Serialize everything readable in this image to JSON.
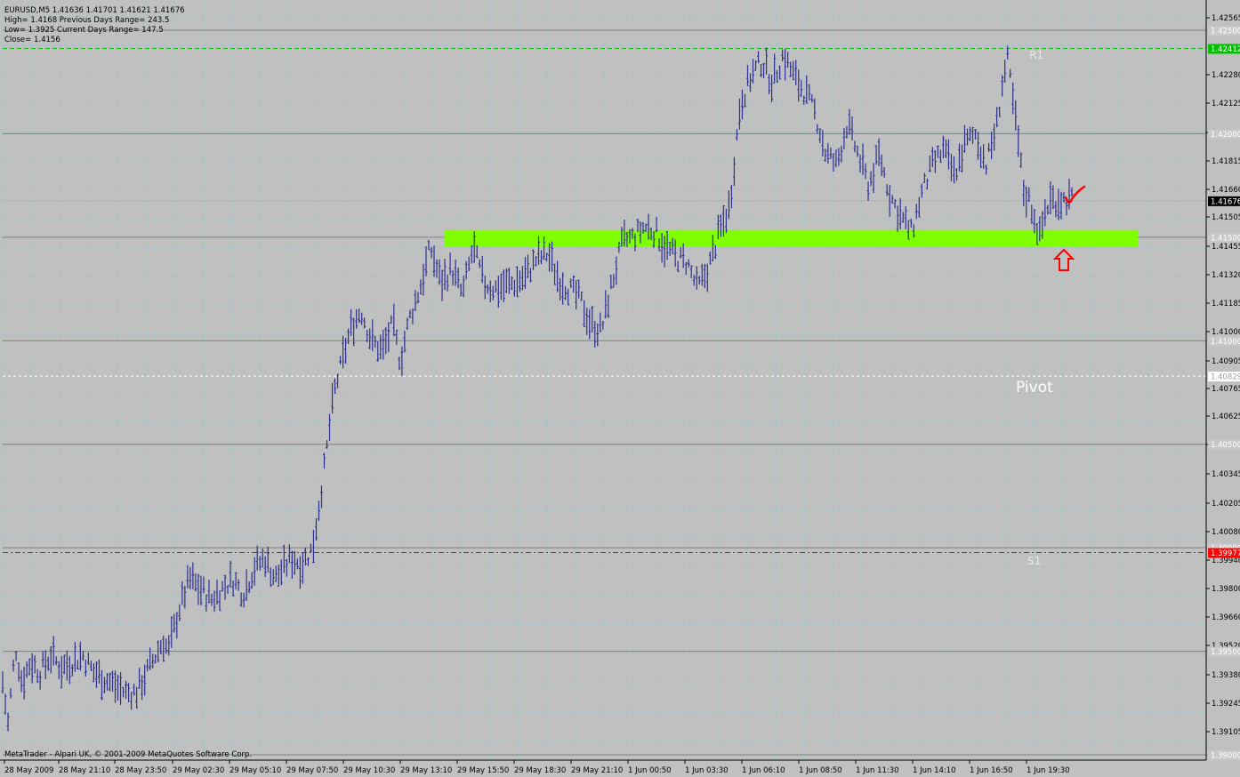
{
  "window": {
    "symbol_header": "EURUSD,M5  1.41636 1.41701 1.41621 1.41676",
    "info_lines": [
      "High= 1.4168      Previous Days Range= 243.5",
      "Low= 1.3925      Current Days Range= 147.5",
      "Close= 1.4156"
    ],
    "copyright": "MetaTrader - Alpari UK, © 2001-2009 MetaQuotes Software Corp."
  },
  "colors": {
    "background": "#c0c0c0",
    "price_bars": "#2f2f8f",
    "grid": "#9ec4c8",
    "pivot_levels": "#808080",
    "support_zone": "#7fff00",
    "r1_line": "#00c000",
    "s1_line": "#ff0000",
    "current_price_tag": "#000000",
    "annotation": "#ff0000"
  },
  "chart_data": {
    "type": "bar",
    "symbol": "EURUSD",
    "timeframe": "M5",
    "ohlc_last": {
      "open": 1.41636,
      "high": 1.41701,
      "low": 1.41621,
      "close": 1.41676
    },
    "ylim": [
      1.3895,
      1.4259
    ],
    "y_ticks": [
      "1.42565",
      "1.42280",
      "1.42125",
      "1.41970",
      "1.41815",
      "1.41660",
      "1.41505",
      "1.41455",
      "1.41320",
      "1.41185",
      "1.41000",
      "1.40905",
      "1.40765",
      "1.40625",
      "1.40485",
      "1.40345",
      "1.40205",
      "1.40080",
      "1.39940",
      "1.39800",
      "1.39660",
      "1.39520",
      "1.39380",
      "1.39245",
      "1.39105"
    ],
    "x_ticks": [
      "28 May 2009",
      "28 May 21:10",
      "28 May 23:50",
      "29 May 02:30",
      "29 May 05:10",
      "29 May 07:50",
      "29 May 10:30",
      "29 May 13:10",
      "29 May 15:50",
      "29 May 18:30",
      "29 May 21:10",
      "1 Jun 00:50",
      "1 Jun 03:30",
      "1 Jun 06:10",
      "1 Jun 08:50",
      "1 Jun 11:30",
      "1 Jun 14:10",
      "1 Jun 16:50",
      "1 Jun 19:30"
    ],
    "levels": [
      {
        "name": "1.42500",
        "value": 1.425
      },
      {
        "name": "1.42412",
        "value": 1.42412
      },
      {
        "name": "1.42000",
        "value": 1.42
      },
      {
        "name": "1.41500",
        "value": 1.415
      },
      {
        "name": "1.41000",
        "value": 1.41
      },
      {
        "name": "1.40829",
        "value": 1.40829
      },
      {
        "name": "1.40500",
        "value": 1.405
      },
      {
        "name": "1.40000",
        "value": 1.4
      },
      {
        "name": "1.39977",
        "value": 1.39977
      },
      {
        "name": "1.39500",
        "value": 1.395
      },
      {
        "name": "1.39000",
        "value": 1.39
      }
    ],
    "current_price": "1.41676",
    "pivot_labels": {
      "r1": "R1",
      "pivot": "Pivot",
      "s1": "S1"
    },
    "support_zone": {
      "from": 1.41455,
      "to": 1.41535
    },
    "price_path": [
      [
        0,
        1.3935
      ],
      [
        0.005,
        1.3915
      ],
      [
        0.012,
        1.3952
      ],
      [
        0.018,
        1.3935
      ],
      [
        0.026,
        1.3945
      ],
      [
        0.035,
        1.394
      ],
      [
        0.045,
        1.3948
      ],
      [
        0.055,
        1.3942
      ],
      [
        0.065,
        1.3945
      ],
      [
        0.075,
        1.3948
      ],
      [
        0.085,
        1.394
      ],
      [
        0.1,
        1.3935
      ],
      [
        0.115,
        1.393
      ],
      [
        0.125,
        1.393
      ],
      [
        0.14,
        1.3945
      ],
      [
        0.15,
        1.3955
      ],
      [
        0.155,
        1.395
      ],
      [
        0.165,
        1.397
      ],
      [
        0.175,
        1.3985
      ],
      [
        0.185,
        1.398
      ],
      [
        0.195,
        1.3975
      ],
      [
        0.205,
        1.398
      ],
      [
        0.215,
        1.3985
      ],
      [
        0.225,
        1.3978
      ],
      [
        0.235,
        1.399
      ],
      [
        0.245,
        1.3995
      ],
      [
        0.255,
        1.3985
      ],
      [
        0.27,
        1.3995
      ],
      [
        0.28,
        1.3992
      ],
      [
        0.29,
        1.4
      ],
      [
        0.3,
        1.4035
      ],
      [
        0.31,
        1.4075
      ],
      [
        0.315,
        1.4085
      ],
      [
        0.325,
        1.4105
      ],
      [
        0.335,
        1.4115
      ],
      [
        0.345,
        1.41
      ],
      [
        0.355,
        1.4095
      ],
      [
        0.365,
        1.4108
      ],
      [
        0.372,
        1.409
      ],
      [
        0.38,
        1.411
      ],
      [
        0.39,
        1.4125
      ],
      [
        0.4,
        1.4145
      ],
      [
        0.41,
        1.4128
      ],
      [
        0.42,
        1.4135
      ],
      [
        0.43,
        1.4122
      ],
      [
        0.44,
        1.4145
      ],
      [
        0.45,
        1.4128
      ],
      [
        0.46,
        1.4125
      ],
      [
        0.47,
        1.4127
      ],
      [
        0.48,
        1.4128
      ],
      [
        0.49,
        1.4132
      ],
      [
        0.5,
        1.414
      ],
      [
        0.51,
        1.4142
      ],
      [
        0.52,
        1.413
      ],
      [
        0.53,
        1.4125
      ],
      [
        0.54,
        1.412
      ],
      [
        0.55,
        1.4108
      ],
      [
        0.56,
        1.4105
      ],
      [
        0.57,
        1.4128
      ],
      [
        0.58,
        1.4148
      ],
      [
        0.59,
        1.415
      ],
      [
        0.6,
        1.4155
      ],
      [
        0.61,
        1.4153
      ],
      [
        0.62,
        1.4145
      ],
      [
        0.63,
        1.414
      ],
      [
        0.64,
        1.4138
      ],
      [
        0.65,
        1.4125
      ],
      [
        0.66,
        1.4135
      ],
      [
        0.67,
        1.4152
      ],
      [
        0.68,
        1.4165
      ],
      [
        0.69,
        1.4215
      ],
      [
        0.7,
        1.4228
      ],
      [
        0.71,
        1.4235
      ],
      [
        0.72,
        1.4225
      ],
      [
        0.73,
        1.4238
      ],
      [
        0.74,
        1.4228
      ],
      [
        0.75,
        1.422
      ],
      [
        0.76,
        1.421
      ],
      [
        0.77,
        1.419
      ],
      [
        0.78,
        1.4185
      ],
      [
        0.79,
        1.4205
      ],
      [
        0.8,
        1.419
      ],
      [
        0.81,
        1.4175
      ],
      [
        0.82,
        1.419
      ],
      [
        0.83,
        1.417
      ],
      [
        0.84,
        1.416
      ],
      [
        0.85,
        1.4152
      ],
      [
        0.86,
        1.4172
      ],
      [
        0.87,
        1.4185
      ],
      [
        0.88,
        1.4192
      ],
      [
        0.89,
        1.418
      ],
      [
        0.9,
        1.4195
      ],
      [
        0.91,
        1.42
      ],
      [
        0.92,
        1.4185
      ],
      [
        0.93,
        1.4205
      ],
      [
        0.935,
        1.4225
      ],
      [
        0.94,
        1.4235
      ],
      [
        0.945,
        1.4215
      ],
      [
        0.95,
        1.4195
      ],
      [
        0.955,
        1.4172
      ],
      [
        0.96,
        1.4168
      ],
      [
        0.965,
        1.416
      ],
      [
        0.97,
        1.415
      ],
      [
        0.975,
        1.4162
      ],
      [
        0.98,
        1.4168
      ]
    ]
  }
}
